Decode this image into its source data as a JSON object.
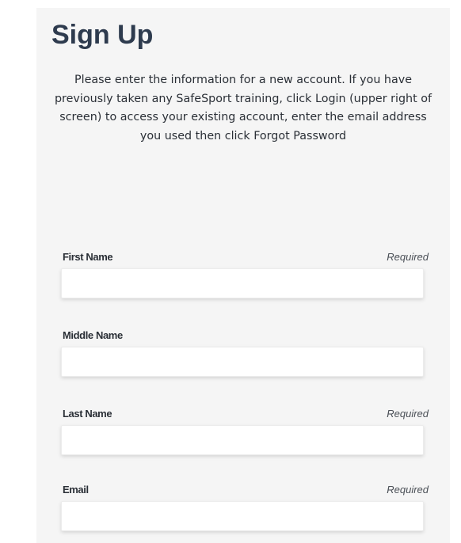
{
  "header": {
    "title": "Sign Up"
  },
  "intro": {
    "text": "Please enter the information for a new account. If you have previously taken any SafeSport training, click Login (upper right of screen) to access your existing account, enter the email address you used then click Forgot Password"
  },
  "form": {
    "required_label": "Required",
    "fields": [
      {
        "label": "First Name",
        "required": true,
        "value": "",
        "placeholder": ""
      },
      {
        "label": "Middle Name",
        "required": false,
        "value": "",
        "placeholder": ""
      },
      {
        "label": "Last Name",
        "required": true,
        "value": "",
        "placeholder": ""
      },
      {
        "label": "Email",
        "required": true,
        "value": "",
        "placeholder": ""
      }
    ]
  },
  "colors": {
    "title": "#2e3b4e",
    "text": "#2a2f36",
    "panel_background": "#f5f5f5",
    "input_background": "#ffffff"
  }
}
